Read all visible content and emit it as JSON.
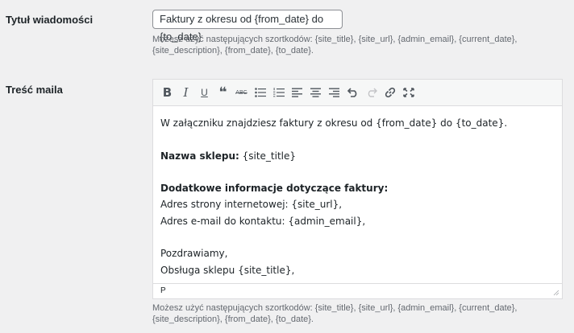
{
  "subject": {
    "label": "Tytuł wiadomości",
    "value": "Faktury z okresu od {from_date} do {to_date}",
    "help_line1": "Możesz użyć następujących szortkodów: {site_title}, {site_url}, {admin_email}, {current_date},",
    "help_line2": "{site_description}, {from_date}, {to_date}."
  },
  "body": {
    "label": "Treść maila",
    "toolbar": {
      "bold": "B",
      "italic": "I",
      "underline": "U",
      "blockquote": "❝",
      "strikethrough": "ABC"
    },
    "content": {
      "line1": "W załączniku znajdziesz faktury z okresu od {from_date} do {to_date}.",
      "shop_label": "Nazwa sklepu:",
      "shop_value": " {site_title}",
      "info_heading": "Dodatkowe informacje dotyczące faktury:",
      "website": "Adres strony internetowej: {site_url},",
      "email": "Adres e-mail do kontaktu: {admin_email},",
      "greeting": "Pozdrawiamy,",
      "signature": "Obsługa sklepu {site_title},"
    },
    "status_path": "P",
    "help_line1": "Możesz użyć następujących szortkodów: {site_title}, {site_url}, {admin_email}, {current_date},",
    "help_line2": "{site_description}, {from_date}, {to_date}."
  },
  "colors": {
    "background": "#f0f0f1",
    "toolbar_icon": "#50575e",
    "disabled_icon": "#c3c4c7",
    "help_text": "#646970"
  }
}
